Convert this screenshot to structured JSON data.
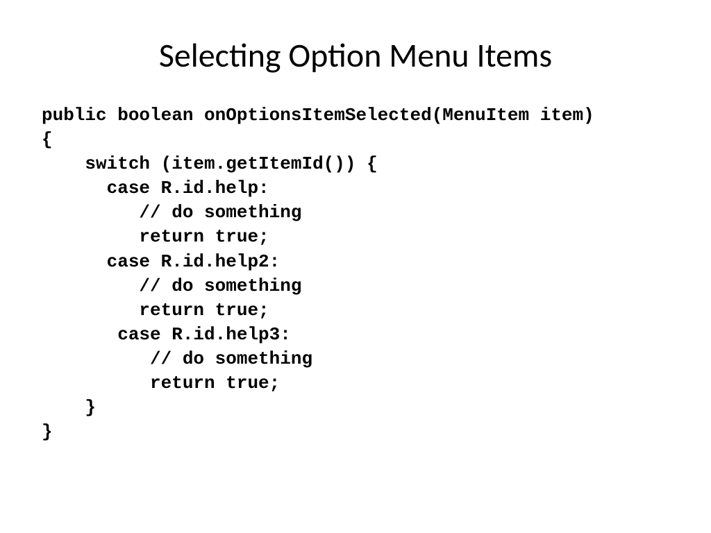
{
  "slide": {
    "title": "Selecting Option Menu Items",
    "code": "public boolean onOptionsItemSelected(MenuItem item)\n{\n    switch (item.getItemId()) {\n      case R.id.help:\n         // do something\n         return true;\n      case R.id.help2:\n         // do something\n         return true;\n       case R.id.help3:\n          // do something\n          return true;\n    }\n}"
  }
}
